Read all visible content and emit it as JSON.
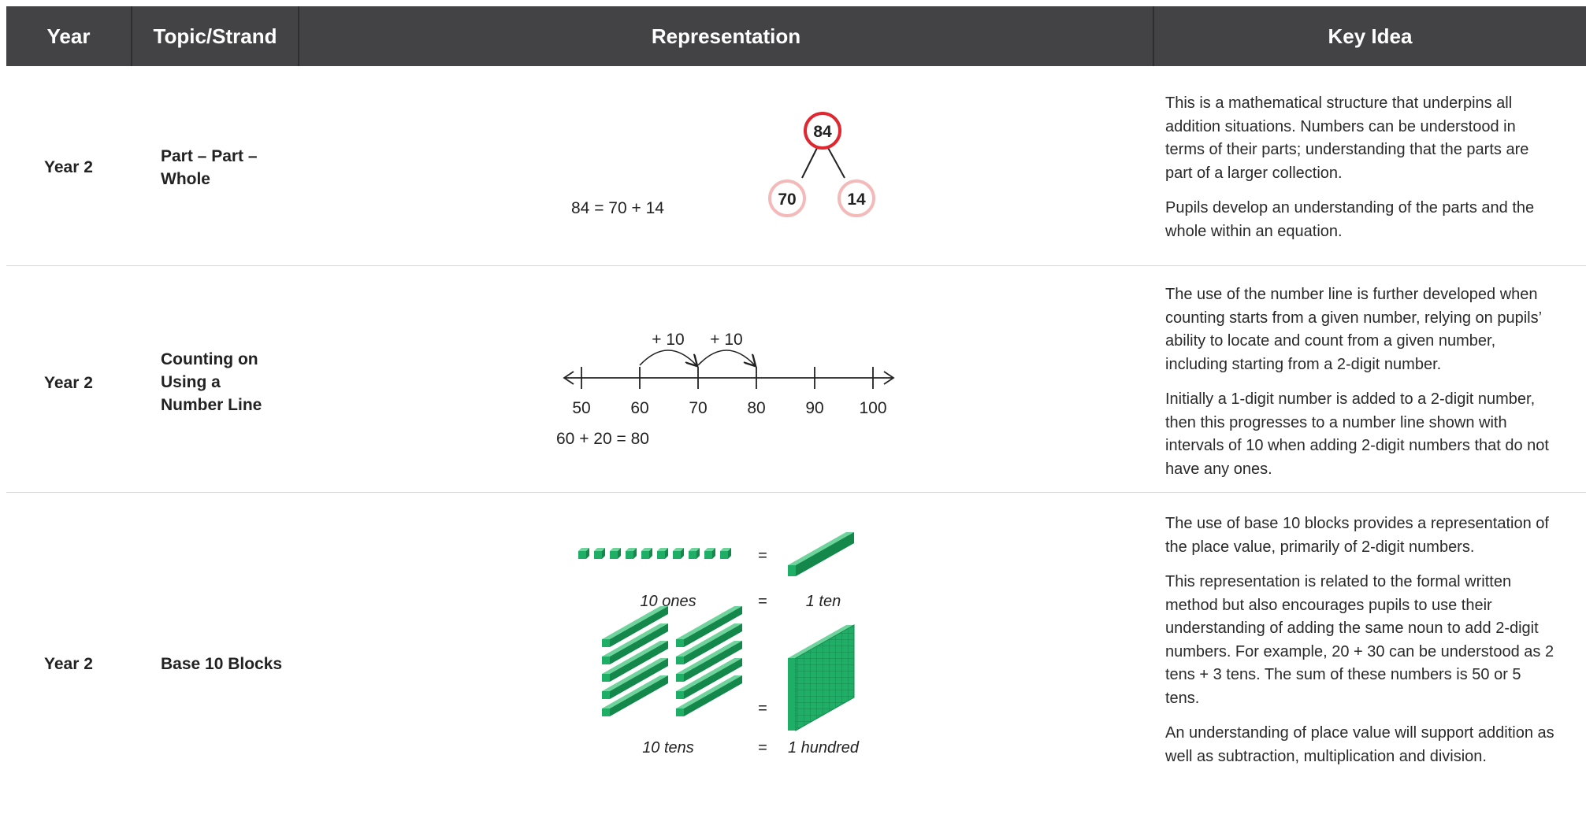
{
  "header": {
    "year": "Year",
    "topic": "Topic/Strand",
    "representation": "Representation",
    "key_idea": "Key Idea"
  },
  "rows": [
    {
      "year": "Year 2",
      "topic": "Part – Part – Whole",
      "equation": "84 = 70 + 14",
      "whole": "84",
      "parts": [
        "70",
        "14"
      ],
      "key_idea": [
        "This is a mathematical structure that underpins all addition situations. Numbers can be understood in terms of their parts; understanding that the parts are part of a larger collection.",
        "Pupils develop an understanding of the parts and the whole within an equation."
      ]
    },
    {
      "year": "Year 2",
      "topic": "Counting on Using a Number Line",
      "jumps": [
        "+ 10",
        "+ 10"
      ],
      "ticks": [
        "50",
        "60",
        "70",
        "80",
        "90",
        "100"
      ],
      "equation": "60 + 20 = 80",
      "key_idea": [
        "The use of the number line is further developed when counting starts from a given number, relying on pupils’ ability to locate and count from a given number, including starting from a 2-digit number.",
        "Initially a 1-digit number is added to a 2-digit number, then this progresses to a number line shown with intervals of 10 when adding 2-digit numbers that do not have any ones."
      ]
    },
    {
      "year": "Year 2",
      "topic": "Base 10 Blocks",
      "equals": "=",
      "label_ones": "10 ones",
      "label_ten": "1 ten",
      "label_tens": "10 tens",
      "label_hundred": "1 hundred",
      "key_idea": [
        "The use of base 10 blocks provides a representation of the place value, primarily of 2-digit numbers.",
        "This representation is related to the formal written method but also encourages pupils to use their understanding of adding the same noun to add 2-digit numbers. For example, 20 + 30 can be understood as 2 tens + 3 tens. The sum of these numbers is 50 or 5 tens.",
        "An understanding of place value will support addition as well as subtraction, multiplication and division."
      ]
    }
  ],
  "colors": {
    "header_bg": "#434345",
    "whole_circle": "#e0262e",
    "part_circle": "#f4b9b9",
    "block_green": "#1fae66"
  }
}
